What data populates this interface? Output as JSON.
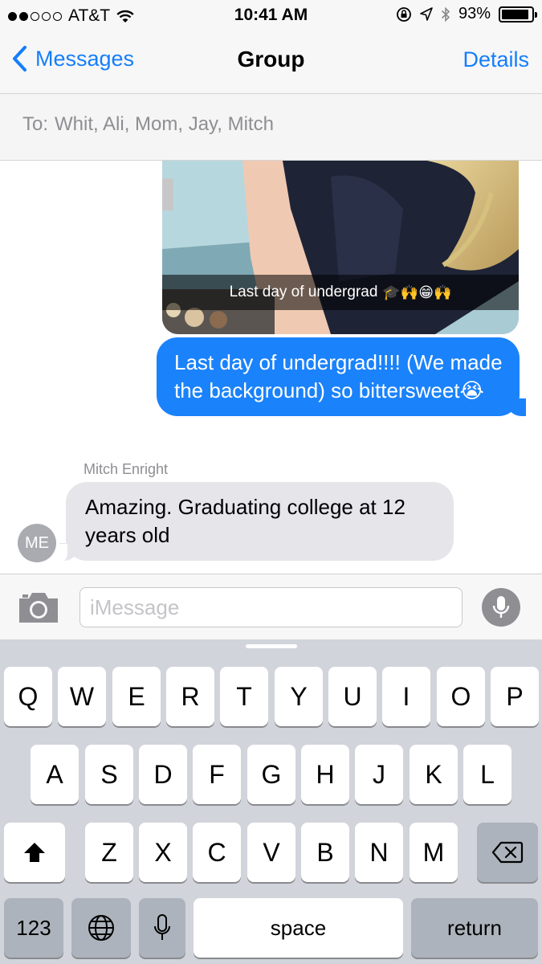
{
  "status_bar": {
    "carrier": "AT&T",
    "time": "10:41 AM",
    "battery": "93%",
    "battery_level": 0.93,
    "signal_bars_filled": 2,
    "signal_bars_total": 5
  },
  "nav": {
    "back_label": "Messages",
    "title": "Group",
    "details_label": "Details"
  },
  "recipients": {
    "prefix": "To:",
    "names": "Whit, Ali, Mom, Jay, Mitch"
  },
  "messages": {
    "photo_caption": "Last day of undergrad",
    "photo_caption_emoji": "🎓🙌😁🙌",
    "outgoing_text": "Last day of undergrad!!!! (We made the background) so bittersweet😭",
    "incoming_sender": "Mitch Enright",
    "incoming_text": "Amazing. Graduating college at 12 years old",
    "avatar_initials": "ME"
  },
  "composer": {
    "placeholder": "iMessage"
  },
  "keyboard": {
    "row1": [
      "Q",
      "W",
      "E",
      "R",
      "T",
      "Y",
      "U",
      "I",
      "O",
      "P"
    ],
    "row2": [
      "A",
      "S",
      "D",
      "F",
      "G",
      "H",
      "J",
      "K",
      "L"
    ],
    "row3": [
      "Z",
      "X",
      "C",
      "V",
      "B",
      "N",
      "M"
    ],
    "numbers_label": "123",
    "space_label": "space",
    "return_label": "return"
  },
  "colors": {
    "accent": "#157efb",
    "outgoing_bubble": "#1a82fb",
    "incoming_bubble": "#e5e5ea",
    "keyboard_bg": "#d1d4da"
  },
  "icons": [
    "back-chevron-icon",
    "wifi-icon",
    "rotation-lock-icon",
    "location-icon",
    "bluetooth-icon",
    "battery-icon",
    "camera-icon",
    "microphone-icon",
    "shift-icon",
    "delete-icon",
    "globe-icon",
    "dictation-icon"
  ]
}
